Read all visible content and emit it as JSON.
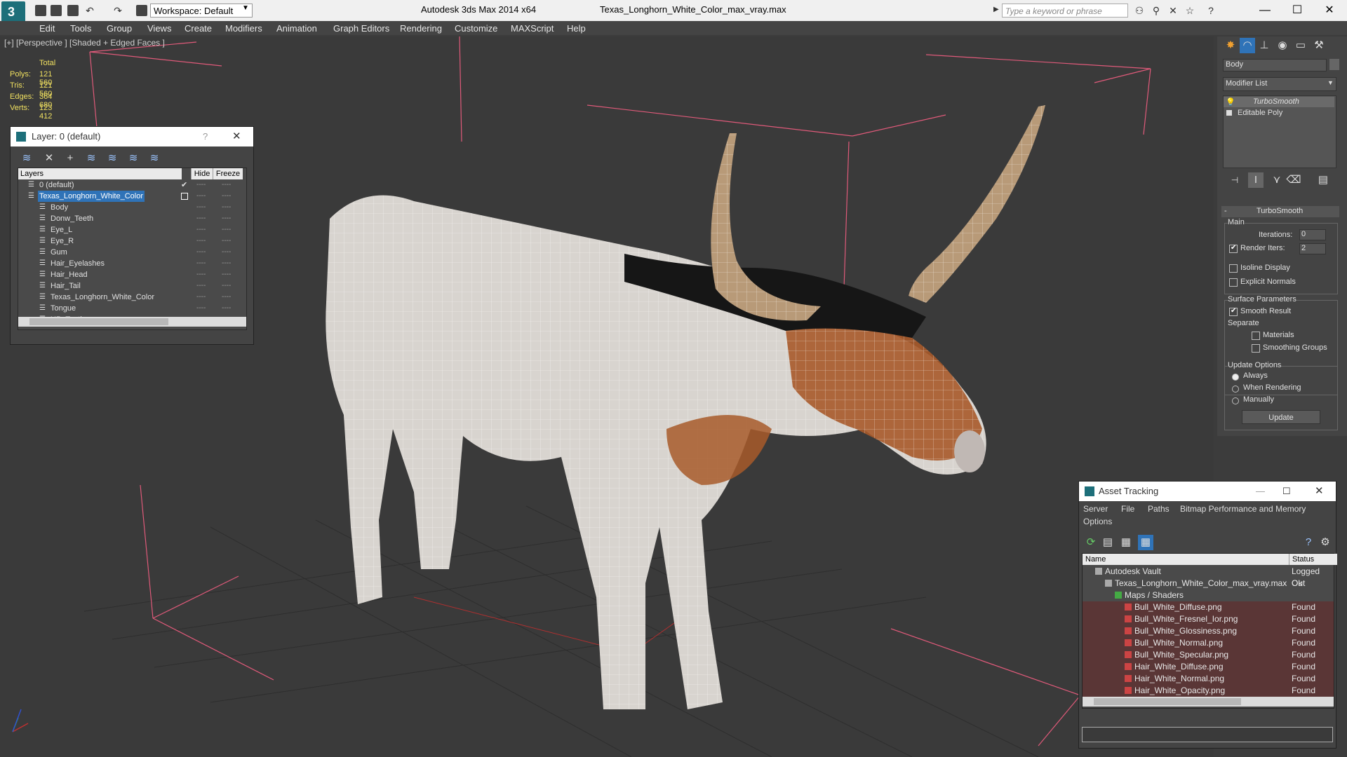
{
  "titlebar": {
    "workspace": "Workspace: Default",
    "app_title": "Autodesk 3ds Max  2014 x64",
    "file_title": "Texas_Longhorn_White_Color_max_vray.max",
    "search_placeholder": "Type a keyword or phrase"
  },
  "menu": [
    "Edit",
    "Tools",
    "Group",
    "Views",
    "Create",
    "Modifiers",
    "Animation",
    "Graph Editors",
    "Rendering",
    "Customize",
    "MAXScript",
    "Help"
  ],
  "viewport": {
    "label": "[+] [Perspective ] [Shaded + Edged Faces ]",
    "stats": {
      "header": "Total",
      "rows": [
        {
          "label": "Polys:",
          "value": "121 560"
        },
        {
          "label": "Tris:",
          "value": "121 560"
        },
        {
          "label": "Edges:",
          "value": "364 680"
        },
        {
          "label": "Verts:",
          "value": "123 412"
        }
      ]
    }
  },
  "layer_dialog": {
    "title": "Layer: 0 (default)",
    "help": "?",
    "columns": {
      "layers": "Layers",
      "hide": "Hide",
      "freeze": "Freeze"
    },
    "rows": [
      {
        "name": "0 (default)",
        "level": 0
      },
      {
        "name": "Texas_Longhorn_White_Color",
        "level": 0
      },
      {
        "name": "Body",
        "level": 1
      },
      {
        "name": "Donw_Teeth",
        "level": 1
      },
      {
        "name": "Eye_L",
        "level": 1
      },
      {
        "name": "Eye_R",
        "level": 1
      },
      {
        "name": "Gum",
        "level": 1
      },
      {
        "name": "Hair_Eyelashes",
        "level": 1
      },
      {
        "name": "Hair_Head",
        "level": 1
      },
      {
        "name": "Hair_Tail",
        "level": 1
      },
      {
        "name": "Texas_Longhorn_White_Color",
        "level": 1
      },
      {
        "name": "Tongue",
        "level": 1
      },
      {
        "name": "UP_Teeth",
        "level": 1
      }
    ],
    "dash": "----"
  },
  "command_panel": {
    "object_name": "Body",
    "modifier_list": "Modifier List",
    "stack": [
      "TurboSmooth",
      "Editable Poly"
    ],
    "rollout_title": "TurboSmooth",
    "main": "Main",
    "iterations_label": "Iterations:",
    "iterations_value": "0",
    "render_iters_label": "Render Iters:",
    "render_iters_value": "2",
    "isoline": "Isoline Display",
    "explicit": "Explicit Normals",
    "surface": "Surface Parameters",
    "smooth_result": "Smooth Result",
    "separate": "Separate",
    "materials": "Materials",
    "smoothing_groups": "Smoothing Groups",
    "update_options": "Update Options",
    "always": "Always",
    "when_rendering": "When Rendering",
    "manually": "Manually",
    "update_button": "Update"
  },
  "asset_tracking": {
    "title": "Asset Tracking",
    "menu": [
      "Server",
      "File",
      "Paths",
      "Bitmap Performance and Memory"
    ],
    "options": "Options",
    "columns": {
      "name": "Name",
      "status": "Status"
    },
    "rows": [
      {
        "name": "Autodesk Vault",
        "status": "Logged Out",
        "level": 0
      },
      {
        "name": "Texas_Longhorn_White_Color_max_vray.max",
        "status": "Ok",
        "level": 1
      },
      {
        "name": "Maps / Shaders",
        "status": "",
        "level": 2
      },
      {
        "name": "Bull_White_Diffuse.png",
        "status": "Found",
        "level": 3
      },
      {
        "name": "Bull_White_Fresnel_Ior.png",
        "status": "Found",
        "level": 3
      },
      {
        "name": "Bull_White_Glossiness.png",
        "status": "Found",
        "level": 3
      },
      {
        "name": "Bull_White_Normal.png",
        "status": "Found",
        "level": 3
      },
      {
        "name": "Bull_White_Specular.png",
        "status": "Found",
        "level": 3
      },
      {
        "name": "Hair_White_Diffuse.png",
        "status": "Found",
        "level": 3
      },
      {
        "name": "Hair_White_Normal.png",
        "status": "Found",
        "level": 3
      },
      {
        "name": "Hair_White_Opacity.png",
        "status": "Found",
        "level": 3
      }
    ]
  },
  "colors": {
    "accent": "#2f73b8",
    "stats": "#f0e060",
    "bbox": "#e05a7a"
  }
}
